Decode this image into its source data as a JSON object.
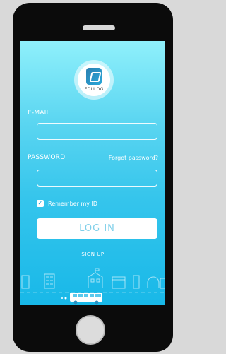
{
  "app": {
    "logo_text": "EDULOG"
  },
  "login_form": {
    "email_label": "E-MAIL",
    "email_value": "",
    "password_label": "PASSWORD",
    "password_value": "",
    "forgot_password": "Forgot password?",
    "remember_label": "Remember my ID",
    "remember_checked": true,
    "checkbox_glyph": "✓",
    "login_label": "LOG IN",
    "signup_label": "SIGN UP"
  },
  "colors": {
    "screen_top": "#8ff0fb",
    "screen_bottom": "#18b8e8",
    "button_text": "#7fcfe9"
  }
}
